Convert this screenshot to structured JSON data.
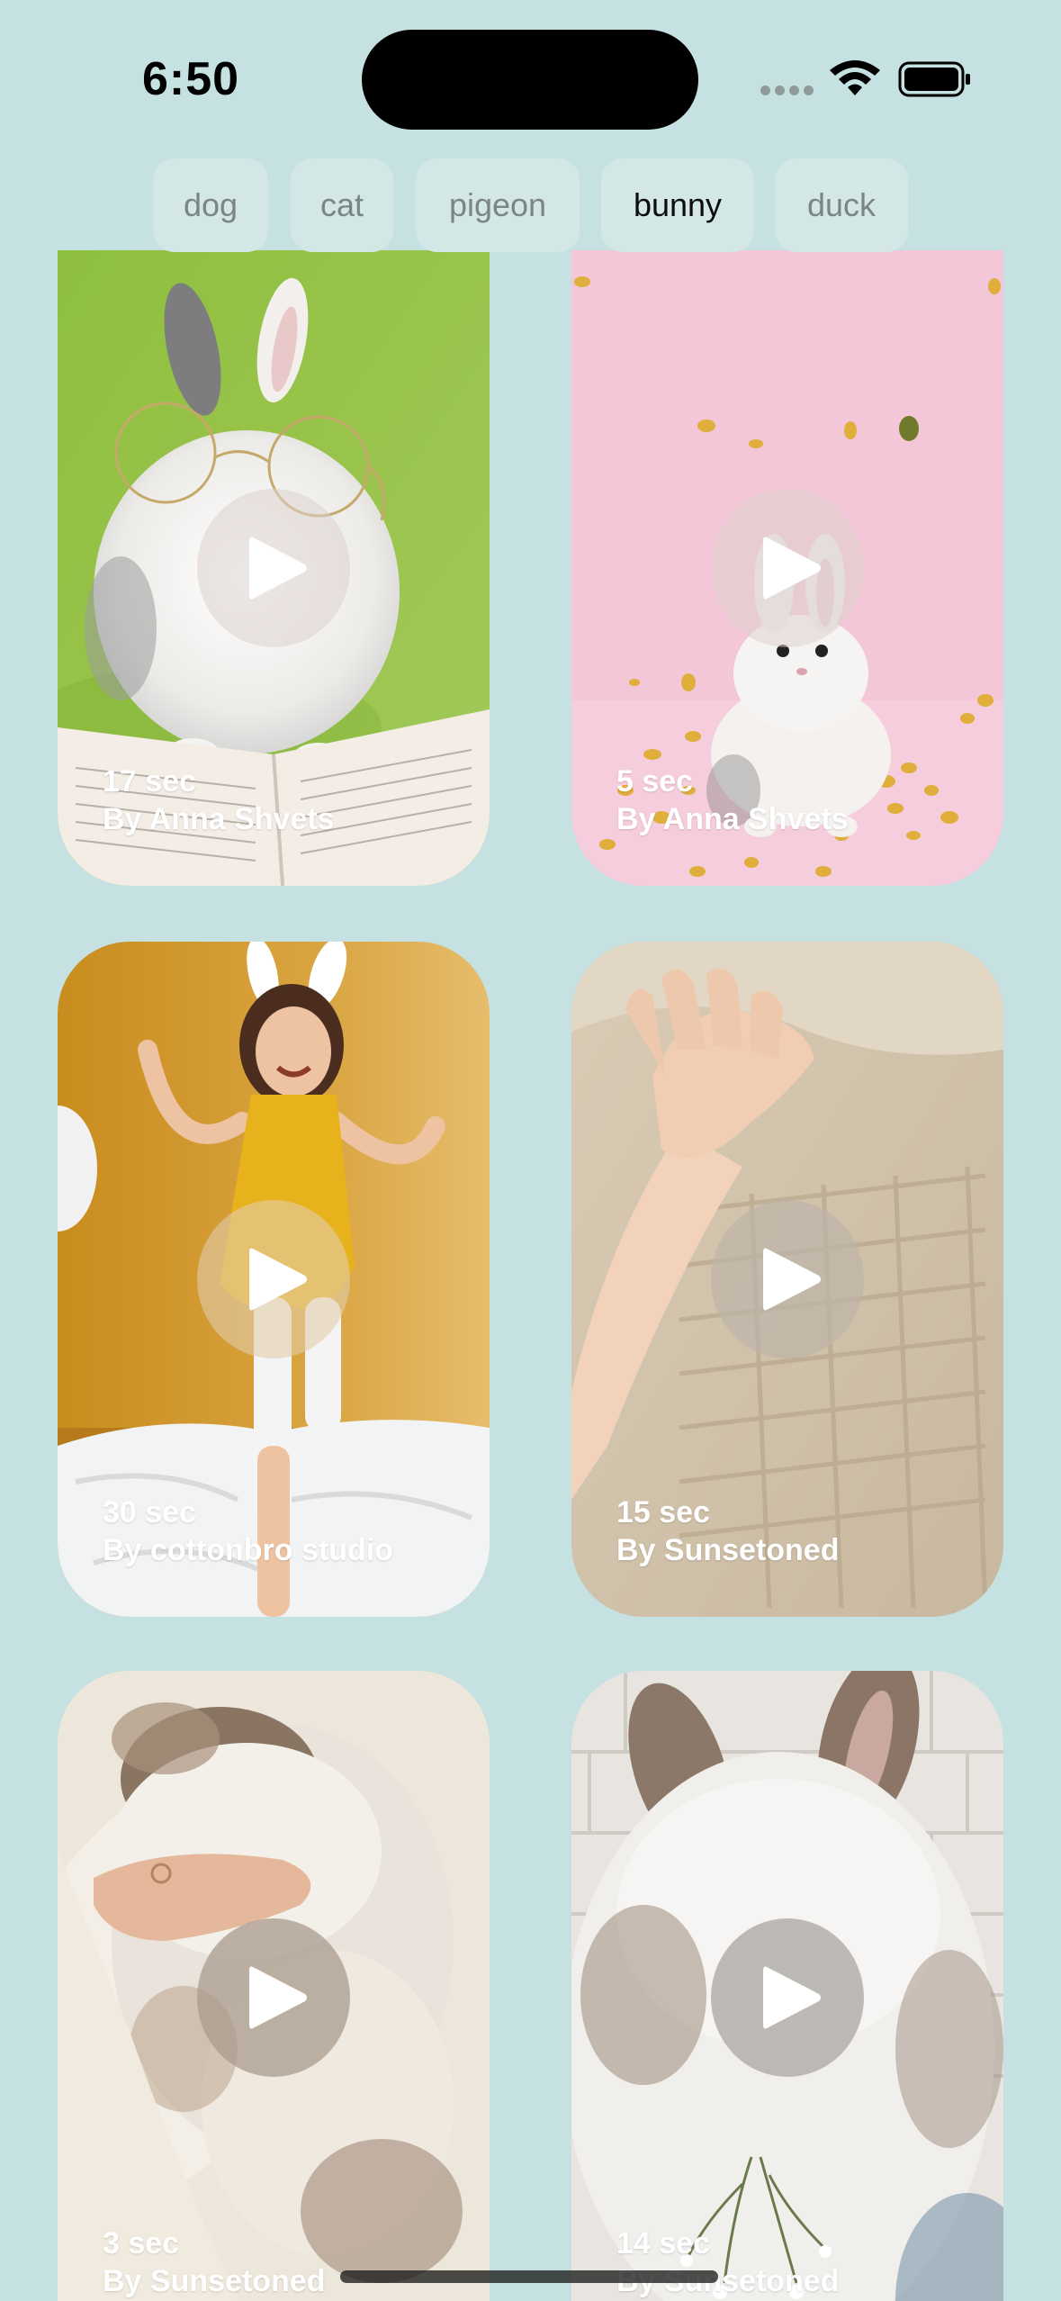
{
  "status_bar": {
    "time": "6:50",
    "icons": [
      "signal-dots-icon",
      "wifi-icon",
      "battery-icon"
    ]
  },
  "tabs": [
    {
      "label": "dog",
      "selected": false
    },
    {
      "label": "cat",
      "selected": false
    },
    {
      "label": "pigeon",
      "selected": false
    },
    {
      "label": "bunny",
      "selected": true
    },
    {
      "label": "duck",
      "selected": false
    }
  ],
  "videos": [
    {
      "duration": "17 sec",
      "author": "By Anna Shvets",
      "icon": "play-icon"
    },
    {
      "duration": "5 sec",
      "author": "By Anna Shvets",
      "icon": "play-icon"
    },
    {
      "duration": "30 sec",
      "author": "By cottonbro studio",
      "icon": "play-icon"
    },
    {
      "duration": "15 sec",
      "author": "By Sunsetoned",
      "icon": "play-icon"
    },
    {
      "duration": "3 sec",
      "author": "By Sunsetoned",
      "icon": "play-icon"
    },
    {
      "duration": "14 sec",
      "author": "By Sunsetoned",
      "icon": "play-icon"
    }
  ],
  "colors": {
    "background": "#c5e1e1",
    "tab_background": "#d3e7e7",
    "tab_text": "#7c8585",
    "tab_text_selected": "#0c0c0c"
  }
}
